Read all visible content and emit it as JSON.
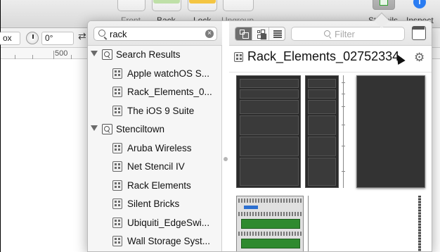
{
  "toolbar": {
    "front_label": "Front",
    "back_label": "Back",
    "lock_label": "Lock",
    "ungroup_label": "Ungroup",
    "stencils_label": "Stencils",
    "inspect_label": "Inspect",
    "inspect_glyph": "i",
    "lock_color": "#f4c542",
    "back_color": "#bfe0a8"
  },
  "format_bar": {
    "size_value": "ox",
    "rotation_value": "0°"
  },
  "ruler": {
    "mark_label": "500"
  },
  "left_pane": {
    "search_value": "rack",
    "clear_glyph": "×",
    "groups": [
      {
        "label": "Search Results",
        "items": [
          {
            "label": "Apple watchOS S..."
          },
          {
            "label": "Rack_Elements_0..."
          },
          {
            "label": "The iOS 9 Suite"
          }
        ]
      },
      {
        "label": "Stenciltown",
        "items": [
          {
            "label": "Aruba Wireless"
          },
          {
            "label": "Net Stencil IV"
          },
          {
            "label": "Rack Elements"
          },
          {
            "label": "Silent Bricks"
          },
          {
            "label": "Ubiquiti_EdgeSwi..."
          },
          {
            "label": "Wall Storage Syst..."
          }
        ]
      }
    ]
  },
  "right_pane": {
    "filter_placeholder": "Filter",
    "stencil_title": "Rack_Elements_02752334",
    "gear_glyph": "⚙",
    "view_modes": [
      "cascade-icon",
      "grid-icon",
      "list-icon"
    ],
    "active_view_mode": "cascade-icon"
  }
}
